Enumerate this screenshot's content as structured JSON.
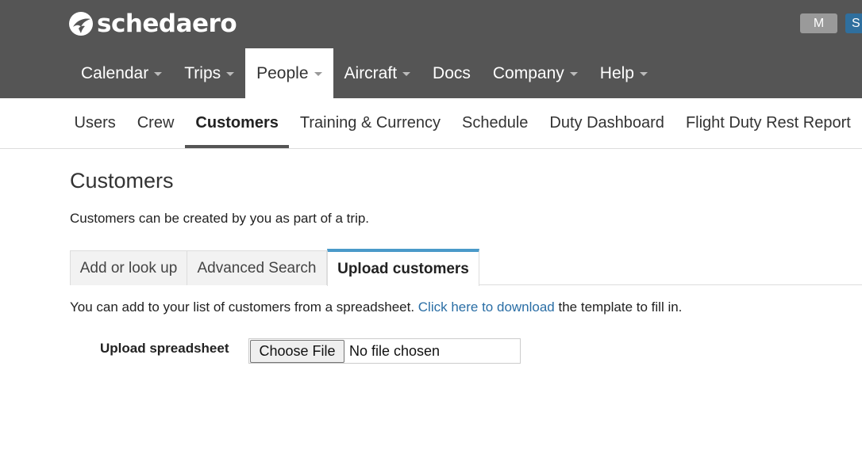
{
  "header": {
    "brand": "schedaero",
    "user_initial": "M",
    "right_button_label": "S"
  },
  "main_nav": [
    {
      "label": "Calendar",
      "has_dropdown": true,
      "active": false
    },
    {
      "label": "Trips",
      "has_dropdown": true,
      "active": false
    },
    {
      "label": "People",
      "has_dropdown": true,
      "active": true
    },
    {
      "label": "Aircraft",
      "has_dropdown": true,
      "active": false
    },
    {
      "label": "Docs",
      "has_dropdown": false,
      "active": false
    },
    {
      "label": "Company",
      "has_dropdown": true,
      "active": false
    },
    {
      "label": "Help",
      "has_dropdown": true,
      "active": false
    }
  ],
  "sub_nav": [
    {
      "label": "Users",
      "active": false
    },
    {
      "label": "Crew",
      "active": false
    },
    {
      "label": "Customers",
      "active": true
    },
    {
      "label": "Training & Currency",
      "active": false
    },
    {
      "label": "Schedule",
      "active": false
    },
    {
      "label": "Duty Dashboard",
      "active": false
    },
    {
      "label": "Flight Duty Rest Report",
      "active": false
    }
  ],
  "page": {
    "title": "Customers",
    "intro": "Customers can be created by you as part of a trip."
  },
  "tabs": [
    {
      "label": "Add or look up",
      "active": false
    },
    {
      "label": "Advanced Search",
      "active": false
    },
    {
      "label": "Upload customers",
      "active": true
    }
  ],
  "upload": {
    "help_prefix": "You can add to your list of customers from a spreadsheet. ",
    "help_link": "Click here to download",
    "help_suffix": " the template to fill in.",
    "label": "Upload spreadsheet",
    "choose_button": "Choose File",
    "file_status": "No file chosen"
  },
  "colors": {
    "header_bg": "#555555",
    "accent_tab": "#4a9ac9",
    "link": "#2a6ea5",
    "right_button": "#2f6f9e"
  }
}
